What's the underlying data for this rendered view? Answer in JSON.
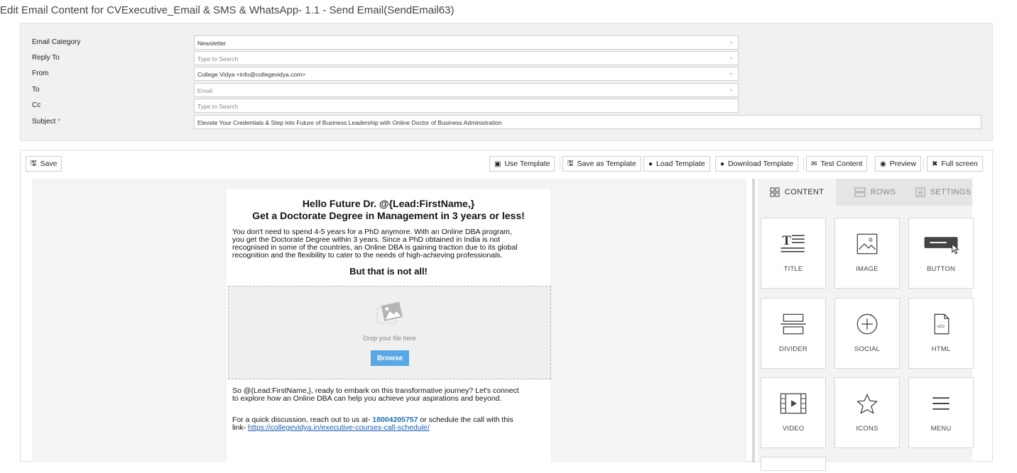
{
  "page": {
    "title": "Edit Email Content for CVExecutive_Email & SMS & WhatsApp- 1.1 - Send Email(SendEmail63)"
  },
  "form": {
    "email_category": {
      "label": "Email Category",
      "value": "Newsletter"
    },
    "reply_to": {
      "label": "Reply To",
      "placeholder": "Type to Search"
    },
    "from": {
      "label": "From",
      "value": "College Vidya <info@collegevidya.com>"
    },
    "to": {
      "label": "To",
      "placeholder": "Email"
    },
    "cc": {
      "label": "Cc",
      "placeholder": "Type to Search"
    },
    "subject": {
      "label": "Subject",
      "required_mark": "*",
      "value": "Elevate Your Credentials & Step into Future of Business Leadership with Online Doctor of Business Administration"
    }
  },
  "toolbar": {
    "save": "Save",
    "use_template": "Use Template",
    "save_as_template": "Save as Template",
    "load_template": "Load Template",
    "download_template": "Download Template",
    "test_content": "Test Content",
    "preview": "Preview",
    "full_screen": "Full screen"
  },
  "email": {
    "heading1": "Hello Future Dr. @{Lead:FirstName,}",
    "heading2": "Get a Doctorate Degree in Management in 3 years or less!",
    "para1_line1": "You don't need to spend 4-5 years for a PhD anymore. With an Online DBA program,",
    "para1_line2": "you get the Doctorate Degree within 3 years. Since a PhD obtained in India is not",
    "para1_line3": "recognised in some of the countries, an Online DBA is gaining traction due to its global",
    "para1_line4": "recognition and the flexibility to cater to the needs of high-achieving professionals.",
    "heading3": "But that is not all!",
    "drop_text": "Drop your file here",
    "browse": "Browse",
    "para2_line1": "So @{Lead:FirstName,}, ready to embark on this transformative journey? Let's connect",
    "para2_line2": "to explore how an Online DBA can help you achieve your aspirations and beyond.",
    "para3_prefix": "For a quick discussion, reach out to us at- ",
    "phone": "18004205757",
    "para3_suffix": " or schedule the call with this",
    "para3_line2_prefix": "link- ",
    "link": "https://collegevidya.in/executive-courses-call-schedule/"
  },
  "side_tabs": {
    "content": "CONTENT",
    "rows": "ROWS",
    "settings": "SETTINGS"
  },
  "tiles": [
    {
      "label": "TITLE",
      "icon": "title-icon"
    },
    {
      "label": "IMAGE",
      "icon": "image-icon"
    },
    {
      "label": "BUTTON",
      "icon": "button-icon"
    },
    {
      "label": "DIVIDER",
      "icon": "divider-icon"
    },
    {
      "label": "SOCIAL",
      "icon": "social-icon"
    },
    {
      "label": "HTML",
      "icon": "html-icon"
    },
    {
      "label": "VIDEO",
      "icon": "video-icon"
    },
    {
      "label": "ICONS",
      "icon": "star-icon"
    },
    {
      "label": "MENU",
      "icon": "menu-icon"
    }
  ],
  "colors": {
    "browse_button": "#58a8e6",
    "phone_text": "#1a6fb0",
    "required_mark": "#d9534f"
  }
}
